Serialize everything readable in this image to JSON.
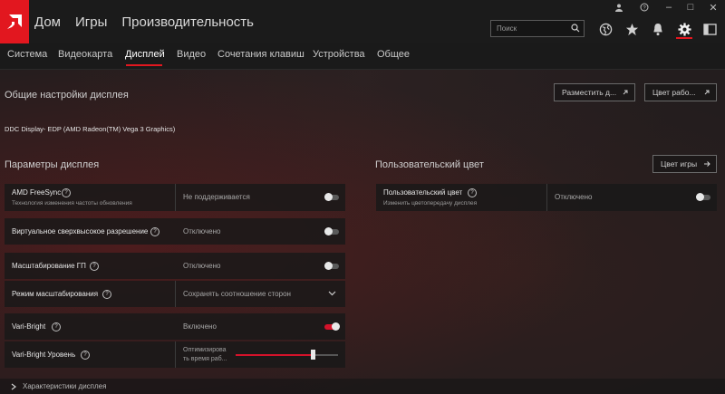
{
  "titlebar": {
    "nav": [
      "Дом",
      "Игры",
      "Производительность"
    ],
    "search_placeholder": "Поиск",
    "window_controls": [
      "?",
      "–",
      "□",
      "✕"
    ]
  },
  "subnav": {
    "tabs": [
      "Система",
      "Видеокарта",
      "Дисплей",
      "Видео",
      "Сочетания клавиш",
      "Устройства",
      "Общее"
    ],
    "active": "Дисплей"
  },
  "display": {
    "general_title": "Общие настройки дисплея",
    "device_name": "DDC Display- EDP (AMD Radeon(TM) Vega 3 Graphics)",
    "btn_place": "Разместить д...",
    "btn_color": "Цвет рабо...",
    "params_title": "Параметры дисплея",
    "custom_color_title": "Пользовательский цвет",
    "btn_game_color": "Цвет игры",
    "freesync_label": "AMD FreeSync",
    "freesync_sub": "Технология изменения частоты обновления",
    "freesync_value": "Не поддерживается",
    "vsr_label": "Виртуальное сверхвысокое разрешение",
    "vsr_value": "Отключено",
    "gpu_scaling_label": "Масштабирование ГП",
    "gpu_scaling_value": "Отключено",
    "scaling_mode_label": "Режим масштабирования",
    "scaling_mode_value": "Сохранять соотношение сторон",
    "varibright_label": "Vari-Bright",
    "varibright_value": "Включено",
    "varibright_level_label": "Vari-Bright Уровень",
    "varibright_level_value_1": "Оптимизирова",
    "varibright_level_value_2": "ть время раб...",
    "varibright_level_fraction": 0.75,
    "custom_color_label": "Пользовательский цвет",
    "custom_color_sub": "Изменить цветопередачу дисплея",
    "custom_color_value": "Отключено",
    "footer_label": "Характеристики дисплея"
  },
  "colors": {
    "accent": "#e2171f",
    "toggle_on": "#d3122a"
  }
}
